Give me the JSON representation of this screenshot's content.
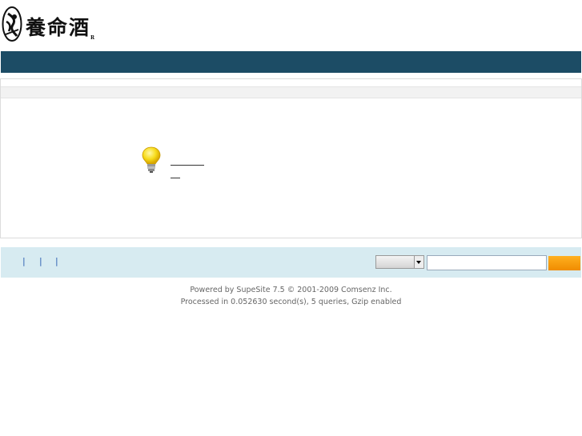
{
  "header": {
    "logo_text": "養命酒",
    "logo_reg": "R"
  },
  "footer_bar": {
    "separators": [
      "|",
      "|",
      "|"
    ],
    "select_value": "",
    "search_value": ""
  },
  "copyright": {
    "line1": "Powered by SupeSite 7.5 © 2001-2009 Comsenz Inc.",
    "line2": "Processed in 0.052630 second(s), 5 queries, Gzip enabled"
  }
}
